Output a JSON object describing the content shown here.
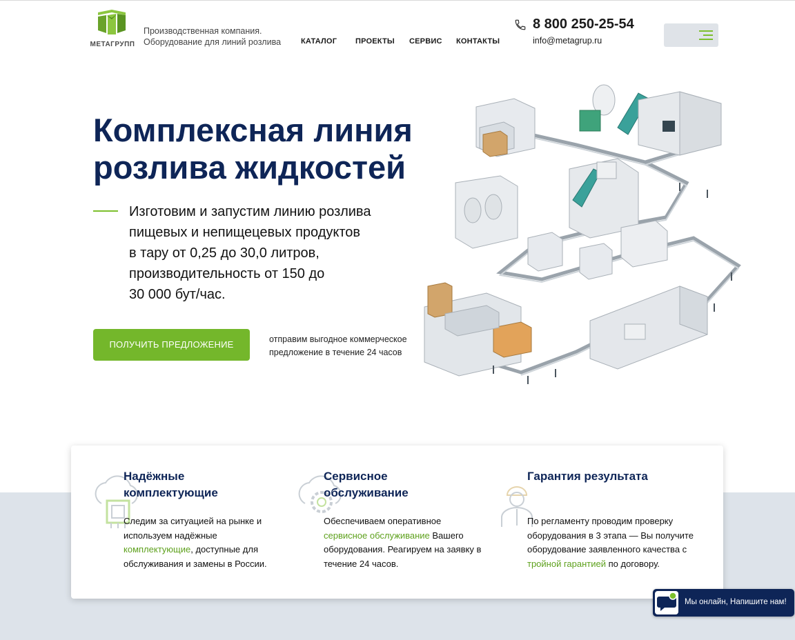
{
  "header": {
    "logo_text": "МЕТАГРУПП",
    "company_desc": "Производственная компания.\nОборудование для линий розлива",
    "nav": [
      "КАТАЛОГ",
      "ПРОЕКТЫ",
      "СЕРВИС",
      "КОНТАКТЫ"
    ],
    "phone": "8 800 250-25-54",
    "email": "info@metagrup.ru",
    "menu_icon": "hamburger-icon"
  },
  "hero": {
    "title": "Комплексная линия розлива жидкостей",
    "description": "Изготовим и запустим линию розлива\nпищевых и непищецевых продуктов\nв тару от 0,25 до 30,0 литров,\nпроизводительность от 150 до\n30 000  бут/час.",
    "cta_label": "ПОЛУЧИТЬ ПРЕДЛОЖЕНИЕ",
    "cta_note": "отправим выгодное коммерческое предложение в течение 24 часов"
  },
  "features": [
    {
      "icon": "chip-cloud-icon",
      "title": "Надёжные комплектующие",
      "text_before": "Следим за ситуацией на рынке и используем надёжные ",
      "link": "комплектующие",
      "text_after": ", доступные для обслуживания и замены в России."
    },
    {
      "icon": "gear-cloud-icon",
      "title": "Сервисное обслуживание",
      "text_before": "Обеспечиваем оперативное ",
      "link": "сервисное обслуживание",
      "text_after": " Вашего оборудования. Реагируем на заявку в течение 24 часов."
    },
    {
      "icon": "engineer-icon",
      "title": "Гарантия результата",
      "text_before": "По регламенту проводим проверку оборудования в 3 этапа — Вы получите оборудование заявленного качества с ",
      "link": "тройной гарантией",
      "text_after": " по договору."
    }
  ],
  "chat": {
    "label": "Мы онлайн, Напишите нам!",
    "icon": "chat-bubble-icon"
  },
  "colors": {
    "navy": "#0e2557",
    "green": "#74b72b",
    "band": "#dde3ea"
  }
}
